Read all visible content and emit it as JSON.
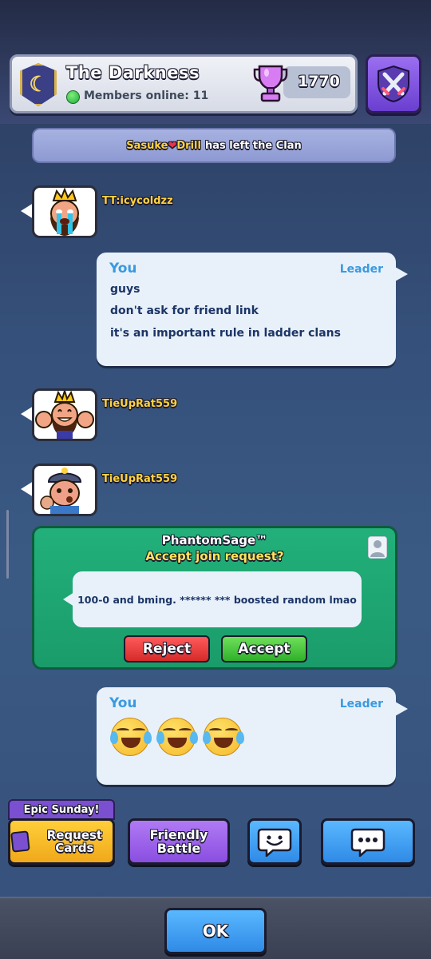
{
  "clan": {
    "name": "The Darkness",
    "members_online": "Members online: 11",
    "trophies": "1770",
    "badge_glyph": "☾"
  },
  "notice": {
    "player": "Sasuke",
    "heart": "❤",
    "player2": "Drill",
    "text": "has left the Clan"
  },
  "messages": [
    {
      "type": "user",
      "name": "TT:icycoldzz",
      "avatar": "crying-king-emote"
    },
    {
      "type": "self",
      "author": "You",
      "role": "Leader",
      "lines": [
        "guys",
        "don't ask for friend link",
        "it's an important rule in ladder clans"
      ]
    },
    {
      "type": "user",
      "name": "TieUpRat559",
      "avatar": "thumbs-up-king-emote"
    },
    {
      "type": "user",
      "name": "TieUpRat559",
      "avatar": "miner-emote"
    },
    {
      "type": "join_request",
      "name": "PhantomSage™",
      "question": "Accept join request?",
      "message": "100-0 and bming. ****** *** boosted random lmao",
      "reject": "Reject",
      "accept": "Accept"
    },
    {
      "type": "self",
      "author": "You",
      "role": "Leader",
      "emojis": [
        "😂",
        "😂",
        "😂"
      ]
    }
  ],
  "actions": {
    "event_tag": "Epic Sunday!",
    "request_cards": "Request Cards",
    "friendly_battle": "Friendly Battle",
    "ok": "OK"
  },
  "colors": {
    "username": "#ffd23f",
    "self_label": "#3a9ae0",
    "join_bg": "#1fa873",
    "accept": "#2fb02a",
    "reject": "#d62a2a"
  }
}
